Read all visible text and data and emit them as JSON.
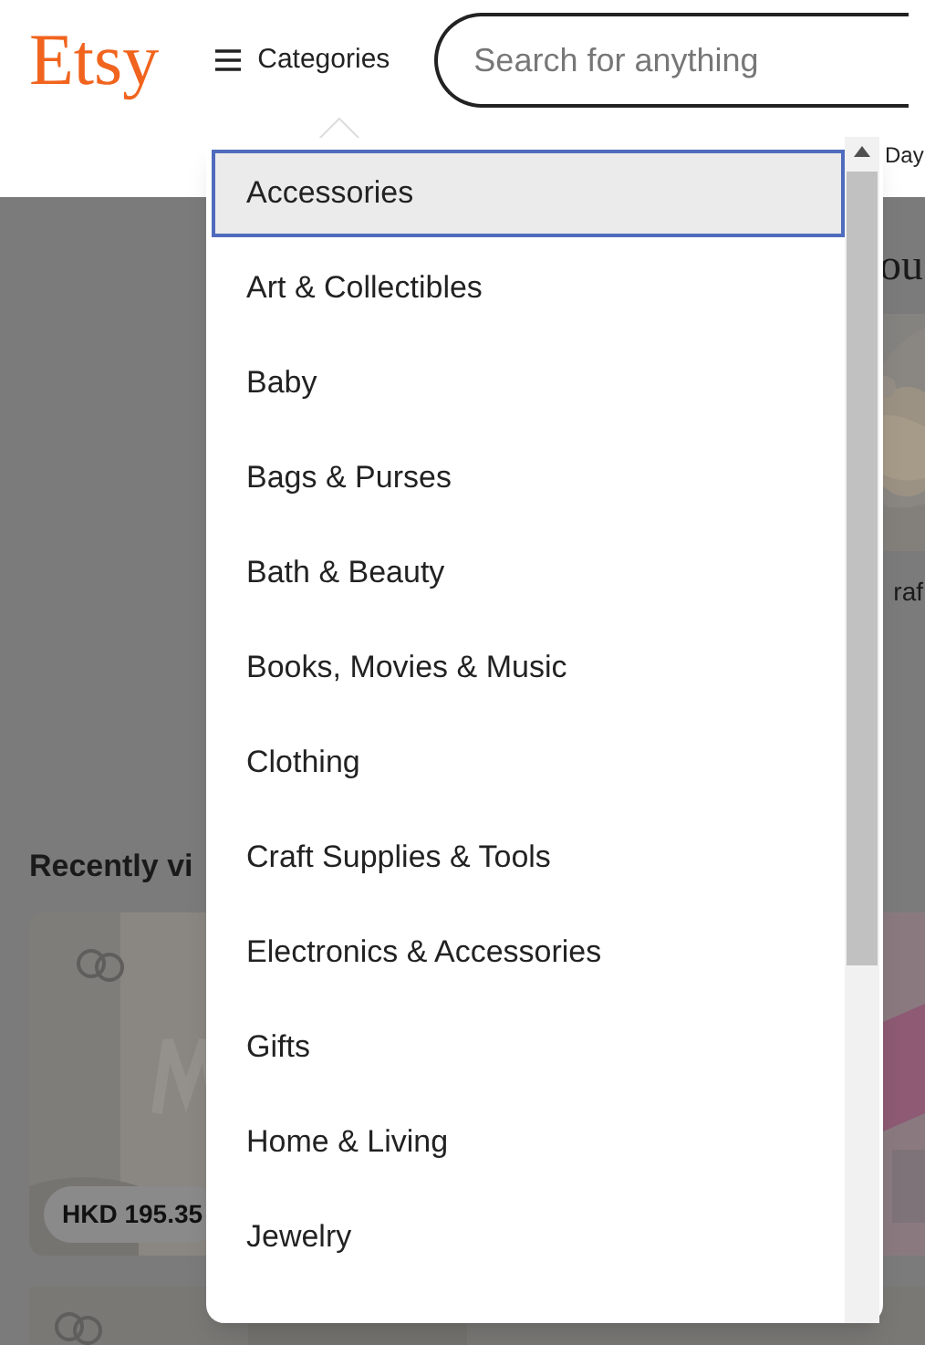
{
  "header": {
    "logo": "Etsy",
    "categories_button": "Categories",
    "search": {
      "placeholder": "Search for anything"
    },
    "nav_link": "Day"
  },
  "page": {
    "heading": "ou",
    "category_label": "raf",
    "recently_viewed_title": "Recently vi",
    "price": "HKD 195.35"
  },
  "dropdown": {
    "items": [
      {
        "label": "Accessories",
        "selected": true
      },
      {
        "label": "Art & Collectibles",
        "selected": false
      },
      {
        "label": "Baby",
        "selected": false
      },
      {
        "label": "Bags & Purses",
        "selected": false
      },
      {
        "label": "Bath & Beauty",
        "selected": false
      },
      {
        "label": "Books, Movies & Music",
        "selected": false
      },
      {
        "label": "Clothing",
        "selected": false
      },
      {
        "label": "Craft Supplies & Tools",
        "selected": false
      },
      {
        "label": "Electronics & Accessories",
        "selected": false
      },
      {
        "label": "Gifts",
        "selected": false
      },
      {
        "label": "Home & Living",
        "selected": false
      },
      {
        "label": "Jewelry",
        "selected": false
      }
    ]
  }
}
